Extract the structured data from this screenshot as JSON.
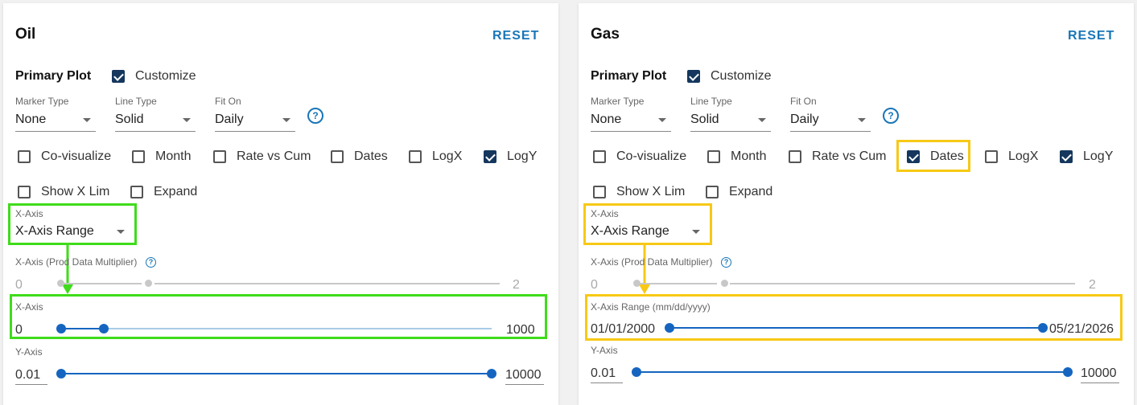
{
  "oil": {
    "title": "Oil",
    "reset_label": "RESET",
    "primary_plot_label": "Primary Plot",
    "customize_label": "Customize",
    "customize_checked": true,
    "marker_type": {
      "label": "Marker Type",
      "value": "None"
    },
    "line_type": {
      "label": "Line Type",
      "value": "Solid"
    },
    "fit_on": {
      "label": "Fit On",
      "value": "Daily"
    },
    "options": [
      {
        "label": "Co-visualize",
        "checked": false
      },
      {
        "label": "Month",
        "checked": false
      },
      {
        "label": "Rate vs Cum",
        "checked": false
      },
      {
        "label": "Dates",
        "checked": false
      },
      {
        "label": "LogX",
        "checked": false
      },
      {
        "label": "LogY",
        "checked": true
      },
      {
        "label": "Show X Lim",
        "checked": false
      },
      {
        "label": "Expand",
        "checked": false
      }
    ],
    "x_axis_select": {
      "label": "X-Axis",
      "value": "X-Axis Range"
    },
    "multiplier": {
      "label": "X-Axis (Prod Data Multiplier)",
      "min": "0",
      "max": "2"
    },
    "x_range": {
      "label": "X-Axis",
      "min": "0",
      "max": "1000"
    },
    "y_range": {
      "label": "Y-Axis",
      "min": "0.01",
      "max": "10000"
    }
  },
  "gas": {
    "title": "Gas",
    "reset_label": "RESET",
    "primary_plot_label": "Primary Plot",
    "customize_label": "Customize",
    "customize_checked": true,
    "marker_type": {
      "label": "Marker Type",
      "value": "None"
    },
    "line_type": {
      "label": "Line Type",
      "value": "Solid"
    },
    "fit_on": {
      "label": "Fit On",
      "value": "Daily"
    },
    "options": [
      {
        "label": "Co-visualize",
        "checked": false
      },
      {
        "label": "Month",
        "checked": false
      },
      {
        "label": "Rate vs Cum",
        "checked": false
      },
      {
        "label": "Dates",
        "checked": true
      },
      {
        "label": "LogX",
        "checked": false
      },
      {
        "label": "LogY",
        "checked": true
      },
      {
        "label": "Show X Lim",
        "checked": false
      },
      {
        "label": "Expand",
        "checked": false
      }
    ],
    "x_axis_select": {
      "label": "X-Axis",
      "value": "X-Axis Range"
    },
    "multiplier": {
      "label": "X-Axis (Prod Data Multiplier)",
      "min": "0",
      "max": "2"
    },
    "x_range": {
      "label": "X-Axis Range (mm/dd/yyyy)",
      "min": "01/01/2000",
      "max": "05/21/2026"
    },
    "y_range": {
      "label": "Y-Axis",
      "min": "0.01",
      "max": "10000"
    }
  },
  "help_glyph": "?",
  "colors": {
    "accent": "#1976b8",
    "checkbox_checked": "#15375e",
    "highlight_oil": "#3fdc1a",
    "highlight_gas": "#f7c915"
  }
}
